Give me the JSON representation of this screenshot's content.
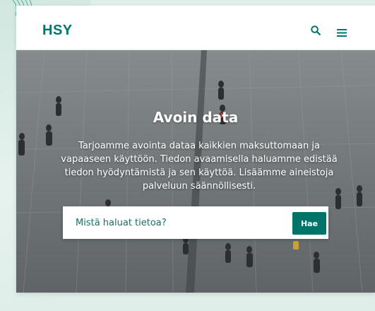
{
  "header": {
    "logo_text": "HSY",
    "search_icon": "search-icon",
    "menu_icon": "hamburger-menu-icon"
  },
  "hero": {
    "title": "Avoin data",
    "description": "Tarjoamme avointa dataa kaikkien maksuttomaan ja vapaaseen käyttöön. Tiedon avaamisella haluamme edistää tiedon hyödyntämistä ja sen käyttöä. Lisäämme aineistoja palveluun säännöllisesti.",
    "background_image": "crowd-on-plaza-photo"
  },
  "search": {
    "placeholder": "Mistä haluat tietoa?",
    "value": "",
    "button_label": "Hae"
  },
  "colors": {
    "brand": "#00756d",
    "button": "#007469",
    "page_background": "#dfeee9"
  }
}
